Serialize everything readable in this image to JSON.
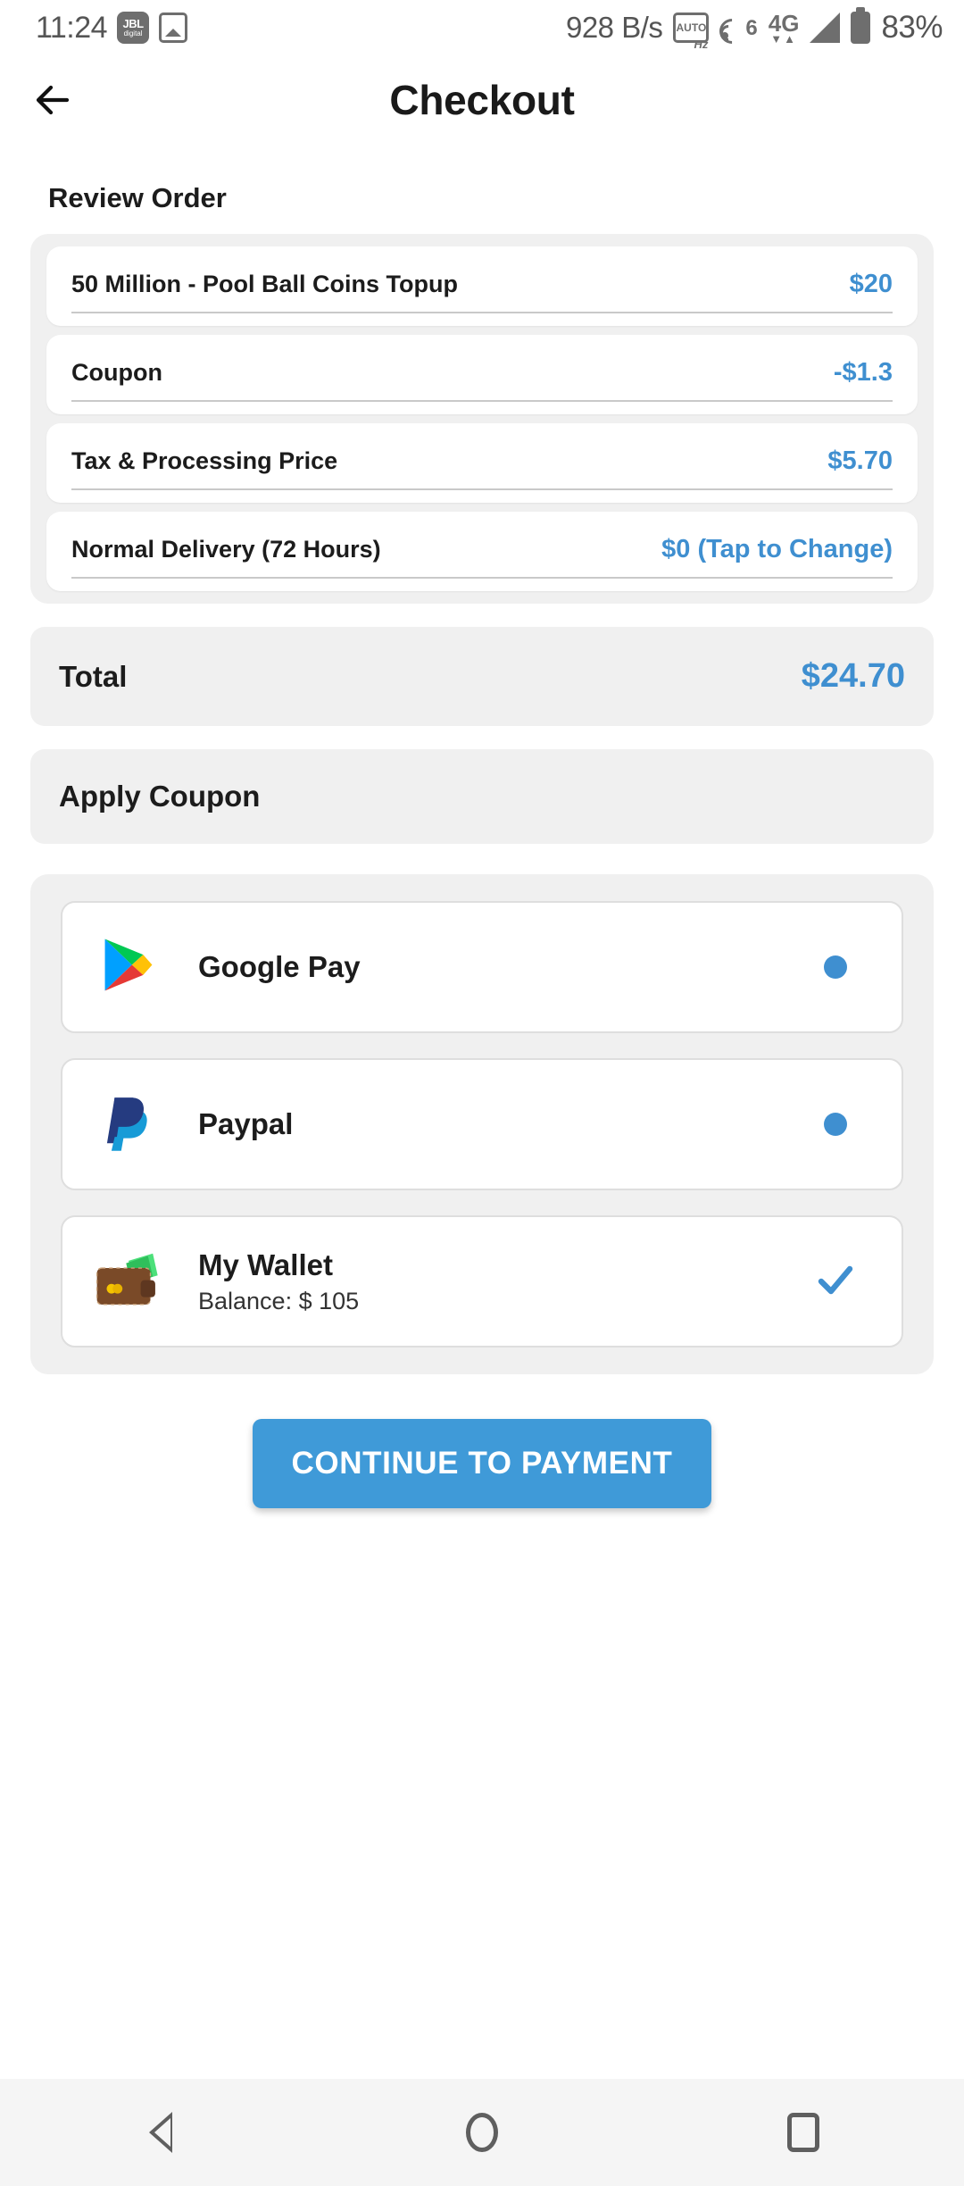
{
  "statusbar": {
    "time": "11:24",
    "jbl_line1": "JBL",
    "jbl_line2": "digital",
    "gallery_icon": "gallery-icon",
    "network_speed": "928 B/s",
    "autohz_label": "AUTO",
    "wifi_generation": "6",
    "mobile_network": "4G",
    "data_arrows": "▼▲",
    "battery_percent": "83%"
  },
  "header": {
    "title": "Checkout",
    "back_icon": "arrow-left-icon"
  },
  "review": {
    "section_title": "Review Order",
    "rows": [
      {
        "label": "50 Million - Pool Ball Coins Topup",
        "value": "$20"
      },
      {
        "label": "Coupon",
        "value": "-$1.3"
      },
      {
        "label": "Tax & Processing Price",
        "value": "$5.70"
      },
      {
        "label": "Normal Delivery (72 Hours)",
        "value": "$0 (Tap to Change)"
      }
    ]
  },
  "total": {
    "label": "Total",
    "value": "$24.70"
  },
  "coupon": {
    "label": "Apply Coupon",
    "value": ""
  },
  "payment": {
    "methods": [
      {
        "name": "Google Pay",
        "subtitle": "",
        "icon": "google-play-icon",
        "state": "radio"
      },
      {
        "name": "Paypal",
        "subtitle": "",
        "icon": "paypal-icon",
        "state": "radio"
      },
      {
        "name": "My Wallet",
        "subtitle": "Balance: $ 105",
        "icon": "wallet-icon",
        "state": "check"
      }
    ]
  },
  "cta": {
    "label": "CONTINUE TO PAYMENT"
  },
  "navbar": {
    "back": "nav-back-icon",
    "home": "nav-home-icon",
    "recents": "nav-recents-icon"
  },
  "colors": {
    "accent_blue": "#3f8fd0",
    "button_blue": "#3f9ad8",
    "panel_gray": "#f0f0f0",
    "text_dark": "#1c1c1c"
  }
}
